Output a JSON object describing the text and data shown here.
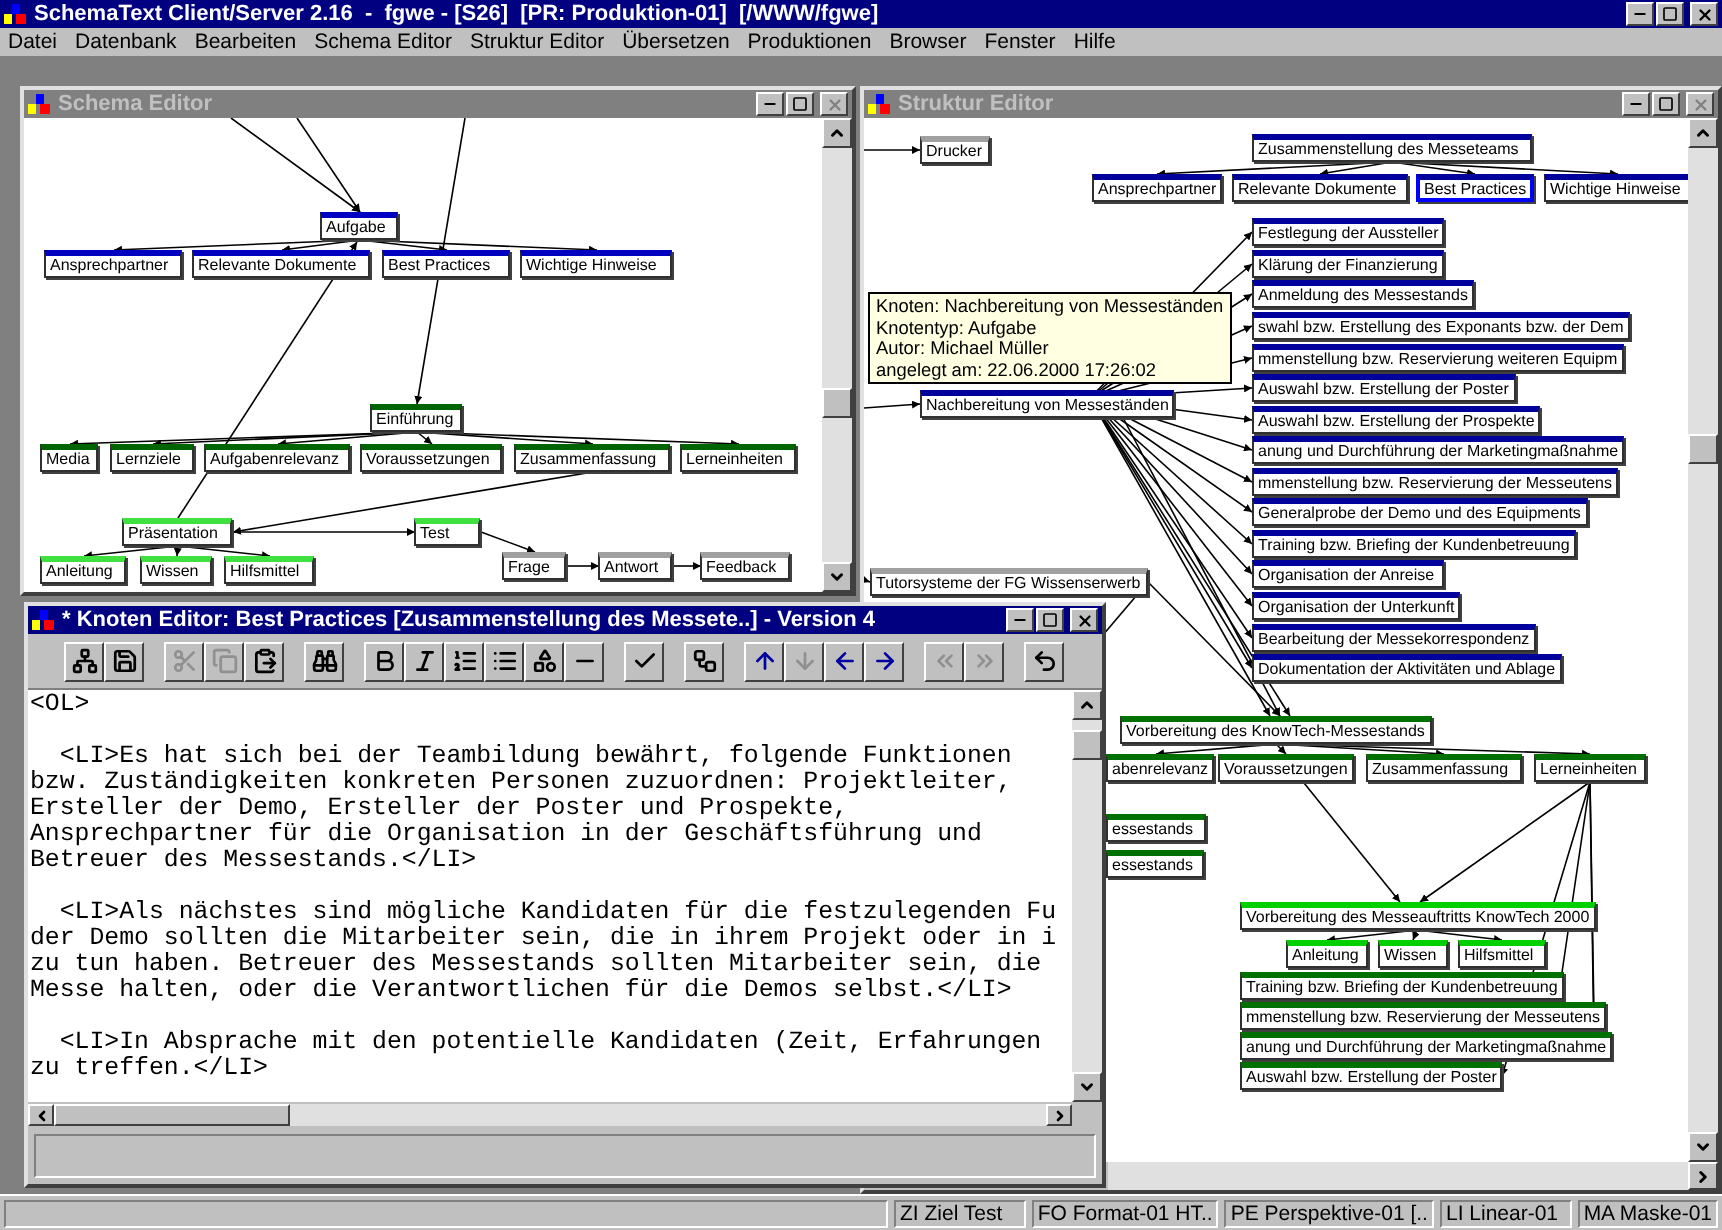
{
  "app_title": "SchemaText Client/Server 2.16  -  fgwe - [S26]  [PR: Produktion-01]  [/WWW/fgwe]",
  "menu": [
    "Datei",
    "Datenbank",
    "Bearbeiten",
    "Schema Editor",
    "Struktur Editor",
    "Übersetzen",
    "Produktionen",
    "Browser",
    "Fenster",
    "Hilfe"
  ],
  "schema_editor": {
    "title": "Schema Editor",
    "nodes": [
      {
        "label": "Aufgabe",
        "color": "#0000c0"
      },
      {
        "label": "Ansprechpartner",
        "color": "#0000c0"
      },
      {
        "label": "Relevante Dokumente",
        "color": "#0000c0"
      },
      {
        "label": "Best Practices",
        "color": "#0000c0"
      },
      {
        "label": "Wichtige Hinweise",
        "color": "#0000c0"
      },
      {
        "label": "Einführung",
        "color": "#006400"
      },
      {
        "label": "Media",
        "color": "#006400"
      },
      {
        "label": "Lernziele",
        "color": "#006400"
      },
      {
        "label": "Aufgabenrelevanz",
        "color": "#006400"
      },
      {
        "label": "Voraussetzungen",
        "color": "#006400"
      },
      {
        "label": "Zusammenfassung",
        "color": "#006400"
      },
      {
        "label": "Lerneinheiten",
        "color": "#006400"
      },
      {
        "label": "Präsentation",
        "color": "#40e040"
      },
      {
        "label": "Test",
        "color": "#40e040"
      },
      {
        "label": "Anleitung",
        "color": "#40e040"
      },
      {
        "label": "Wissen",
        "color": "#40e040"
      },
      {
        "label": "Hilfsmittel",
        "color": "#40e040"
      },
      {
        "label": "Frage",
        "color": "#a0a0a0"
      },
      {
        "label": "Antwort",
        "color": "#a0a0a0"
      },
      {
        "label": "Feedback",
        "color": "#a0a0a0"
      }
    ]
  },
  "struktur_editor": {
    "title": "Struktur Editor",
    "nodes": [
      {
        "label": "Drucker",
        "color": "#a0a0a0",
        "selected": false
      },
      {
        "label": "Zusammenstellung des Messeteams",
        "color": "#00009c",
        "selected": false
      },
      {
        "label": "Ansprechpartner",
        "color": "#00009c",
        "selected": false
      },
      {
        "label": "Relevante Dokumente",
        "color": "#00009c",
        "selected": false
      },
      {
        "label": "Best Practices",
        "color": "#00009c",
        "selected": true
      },
      {
        "label": "Wichtige Hinweise",
        "color": "#00009c",
        "selected": false
      },
      {
        "label": "Festlegung der Aussteller",
        "color": "#00009c",
        "selected": false
      },
      {
        "label": "Klärung der Finanzierung",
        "color": "#00009c",
        "selected": false
      },
      {
        "label": "Anmeldung des Messestands",
        "color": "#00009c",
        "selected": false
      },
      {
        "label": "swahl bzw. Erstellung des Exponants bzw. der Dem",
        "color": "#00009c",
        "selected": false
      },
      {
        "label": "mmenstellung bzw. Reservierung weiteren Equipm",
        "color": "#00009c",
        "selected": false
      },
      {
        "label": "Auswahl bzw. Erstellung der Poster",
        "color": "#00009c",
        "selected": false
      },
      {
        "label": "Auswahl bzw. Erstellung der Prospekte",
        "color": "#00009c",
        "selected": false
      },
      {
        "label": "anung und Durchführung der Marketingmaßnahme",
        "color": "#00009c",
        "selected": false
      },
      {
        "label": "mmenstellung bzw. Reservierung der Messeutens",
        "color": "#00009c",
        "selected": false
      },
      {
        "label": "Generalprobe der Demo und des Equipments",
        "color": "#00009c",
        "selected": false
      },
      {
        "label": "Training bzw. Briefing der Kundenbetreuung",
        "color": "#00009c",
        "selected": false
      },
      {
        "label": "Organisation der Anreise",
        "color": "#00009c",
        "selected": false
      },
      {
        "label": "Organisation der Unterkunft",
        "color": "#00009c",
        "selected": false
      },
      {
        "label": "Bearbeitung der Messekorrespondenz",
        "color": "#00009c",
        "selected": false
      },
      {
        "label": "Dokumentation der Aktivitäten und Ablage",
        "color": "#00009c",
        "selected": false
      },
      {
        "label": "Nachbereitung von Messeständen",
        "color": "#00009c",
        "selected": false
      },
      {
        "label": "Tutorsysteme der FG Wissenserwerb",
        "color": "#a0a0a0",
        "selected": false
      },
      {
        "label": "Vorbereitung des KnowTech-Messestands",
        "color": "#007000",
        "selected": false
      },
      {
        "label": "abenrelevanz",
        "color": "#007000",
        "selected": false
      },
      {
        "label": "Voraussetzungen",
        "color": "#007000",
        "selected": false
      },
      {
        "label": "Zusammenfassung",
        "color": "#007000",
        "selected": false
      },
      {
        "label": "Lerneinheiten",
        "color": "#007000",
        "selected": false
      },
      {
        "label": "essestands",
        "color": "#007000",
        "selected": false
      },
      {
        "label": "essestands",
        "color": "#007000",
        "selected": false
      },
      {
        "label": "Vorbereitung des Messeauftritts KnowTech 2000",
        "color": "#00d000",
        "selected": false
      },
      {
        "label": "Anleitung",
        "color": "#00d000",
        "selected": false
      },
      {
        "label": "Wissen",
        "color": "#00d000",
        "selected": false
      },
      {
        "label": "Hilfsmittel",
        "color": "#00d000",
        "selected": false
      },
      {
        "label": "Training bzw. Briefing der Kundenbetreuung",
        "color": "#007000",
        "selected": false
      },
      {
        "label": "mmenstellung bzw. Reservierung der Messeutens",
        "color": "#007000",
        "selected": false
      },
      {
        "label": "anung und Durchführung der Marketingmaßnahme",
        "color": "#007000",
        "selected": false
      },
      {
        "label": "Auswahl bzw. Erstellung der Poster",
        "color": "#007000",
        "selected": false
      }
    ],
    "tooltip": [
      "Knoten: Nachbereitung von Messeständen",
      "Knotentyp: Aufgabe",
      "Autor: Michael Müller",
      "angelegt am: 22.06.2000 17:26:02"
    ]
  },
  "knoten_editor": {
    "title": "* Knoten Editor: Best Practices [Zusammenstellung des Messete..] - Version 4",
    "toolbar": [
      {
        "disabled": false
      },
      {
        "disabled": false
      },
      {
        "disabled": true
      },
      {
        "disabled": true
      },
      {
        "disabled": false
      },
      {
        "disabled": false
      },
      {
        "disabled": false
      },
      {
        "disabled": false
      },
      {
        "disabled": false
      },
      {
        "disabled": false
      },
      {
        "disabled": false
      },
      {
        "disabled": false
      },
      {
        "disabled": false
      },
      {
        "disabled": false
      },
      {
        "disabled": false
      },
      {
        "disabled": true
      },
      {
        "disabled": false
      },
      {
        "disabled": false
      },
      {
        "disabled": true
      },
      {
        "disabled": true
      },
      {
        "disabled": false
      }
    ],
    "paragraphs": [
      [
        "<OL>"
      ],
      [
        "  <LI>Es hat sich bei der Teambildung bewährt, folgende Funktionen",
        "bzw. Zuständigkeiten konkreten Personen zuzuordnen: Projektleiter,",
        "Ersteller der Demo, Ersteller der Poster und Prospekte,",
        "Ansprechpartner für die Organisation in der Geschäftsführung und",
        "Betreuer des Messestands.</LI>"
      ],
      [
        "  <LI>Als nächstes sind mögliche Kandidaten für die festzulegenden Fu",
        "der Demo sollten die Mitarbeiter sein, die in ihrem Projekt oder in i",
        "zu tun haben. Betreuer des Messestands sollten Mitarbeiter sein, die",
        "Messe halten, oder die Verantwortlichen für die Demos selbst.</LI>"
      ],
      [
        "  <LI>In Absprache mit den potentielle Kandidaten (Zeit, Erfahrungen",
        "zu treffen.</LI>"
      ]
    ]
  },
  "status_bar": [
    "ZI Ziel Test",
    "FO Format-01 HT..",
    "PE Perspektive-01 [..",
    "LI Linear-01",
    "MA Maske-01"
  ]
}
